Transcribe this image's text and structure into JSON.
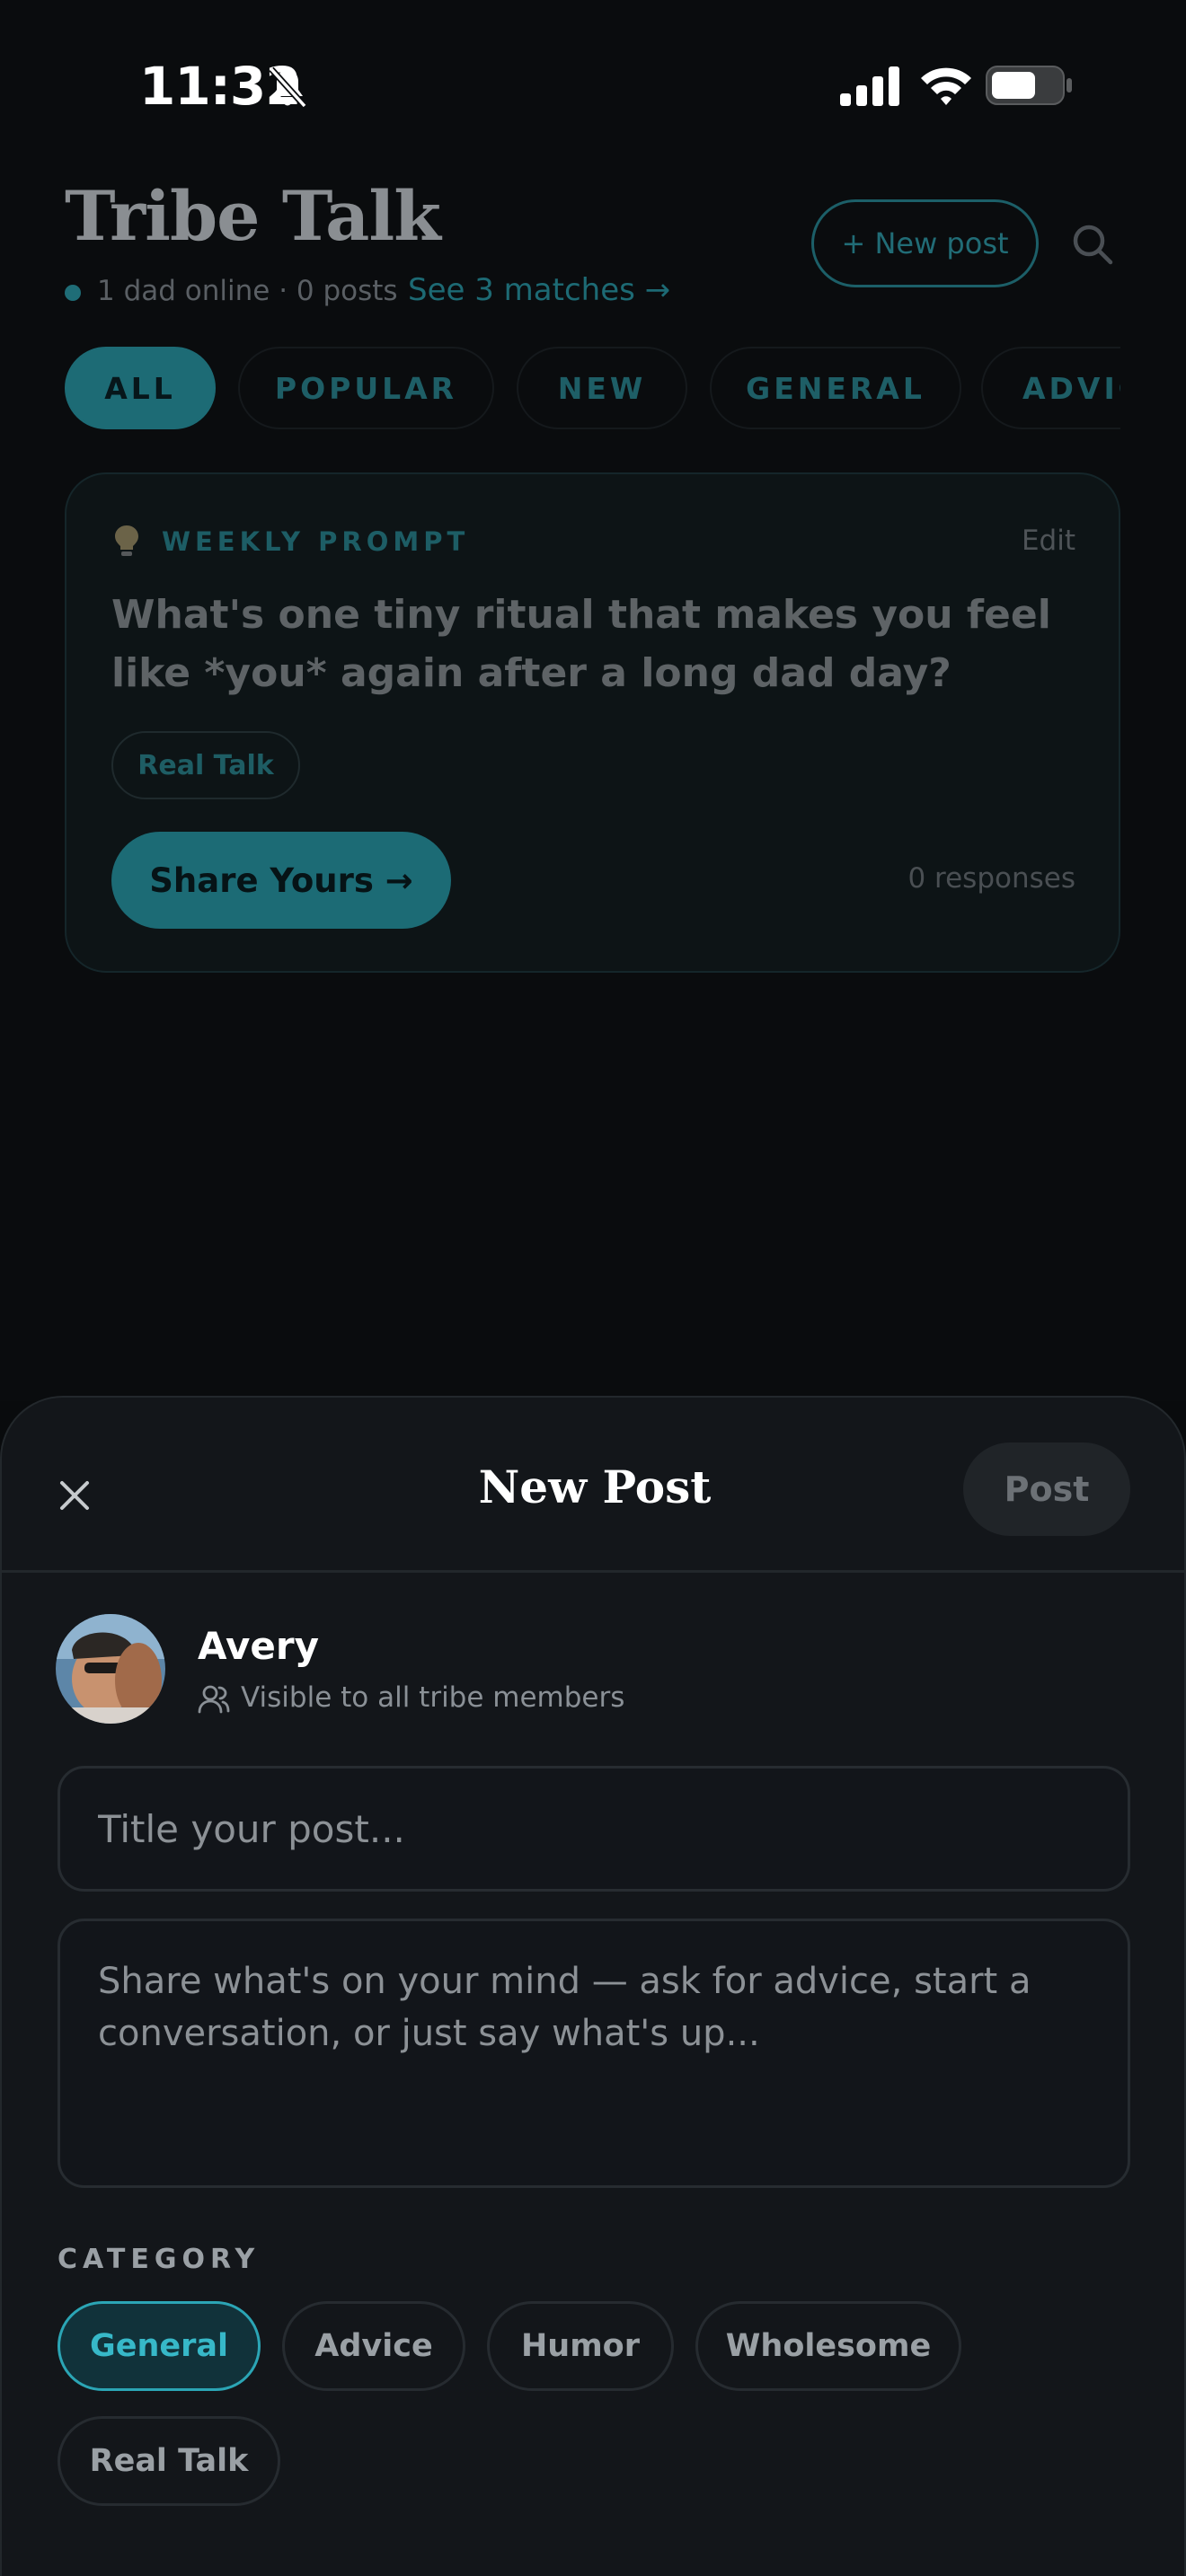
{
  "status_bar": {
    "time": "11:32"
  },
  "header": {
    "title": "Tribe Talk",
    "online_status": "1 dad online · 0 posts",
    "matches_link": "See 3 matches →",
    "new_post_label": "+ New post"
  },
  "filters": [
    "ALL",
    "POPULAR",
    "NEW",
    "GENERAL",
    "ADVICE"
  ],
  "weekly_prompt": {
    "label": "WEEKLY PROMPT",
    "edit_label": "Edit",
    "question": "What's one tiny ritual that makes you feel like *you* again after a long dad day?",
    "tag": "Real Talk",
    "share_label": "Share Yours →",
    "responses": "0 responses"
  },
  "sheet": {
    "title": "New Post",
    "post_label": "Post",
    "author": {
      "name": "Avery",
      "visibility": "Visible to all tribe members"
    },
    "title_placeholder": "Title your post...",
    "body_placeholder": "Share what's on your mind — ask for advice, start a conversation, or just say what's up...",
    "category_label": "CATEGORY",
    "categories": [
      "General",
      "Advice",
      "Humor",
      "Wholesome",
      "Real Talk"
    ],
    "selected_category": "General"
  },
  "colors": {
    "accent": "#37b8c8",
    "accent_dim": "#1d6b75",
    "sheet_bg": "#13161a",
    "page_bg": "#0a0c0e"
  },
  "icons": [
    "bell-slash-icon",
    "cellular-signal-icon",
    "wifi-icon",
    "battery-icon",
    "search-icon",
    "lightbulb-icon",
    "close-icon",
    "people-icon"
  ]
}
